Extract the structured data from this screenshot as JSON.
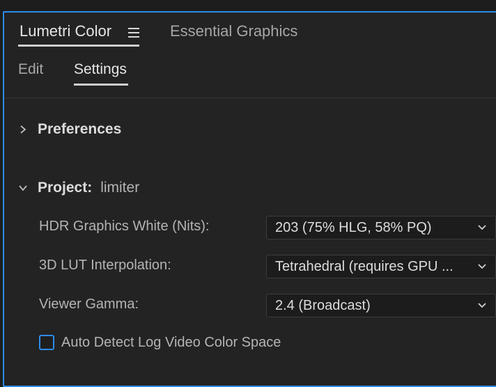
{
  "tabs": {
    "lumetri": "Lumetri Color",
    "essential": "Essential Graphics"
  },
  "subtabs": {
    "edit": "Edit",
    "settings": "Settings"
  },
  "preferences": {
    "title": "Preferences",
    "expanded": false
  },
  "project": {
    "title": "Project:",
    "name": "limiter",
    "expanded": true,
    "fields": [
      {
        "label": "HDR Graphics White (Nits):",
        "value": "203 (75% HLG, 58% PQ)"
      },
      {
        "label": "3D LUT Interpolation:",
        "value": "Tetrahedral (requires GPU ..."
      },
      {
        "label": "Viewer Gamma:",
        "value": "2.4 (Broadcast)"
      }
    ],
    "checkbox": {
      "label": "Auto Detect Log Video Color Space",
      "checked": false
    }
  },
  "colors": {
    "accent": "#2d8ceb",
    "panel_bg": "#232323",
    "dropdown_bg": "#1c1c1c"
  },
  "icons": {
    "menu": "hamburger-icon",
    "collapsed": "chevron-right-icon",
    "expanded": "chevron-down-icon",
    "dropdown": "chevron-down-icon"
  }
}
